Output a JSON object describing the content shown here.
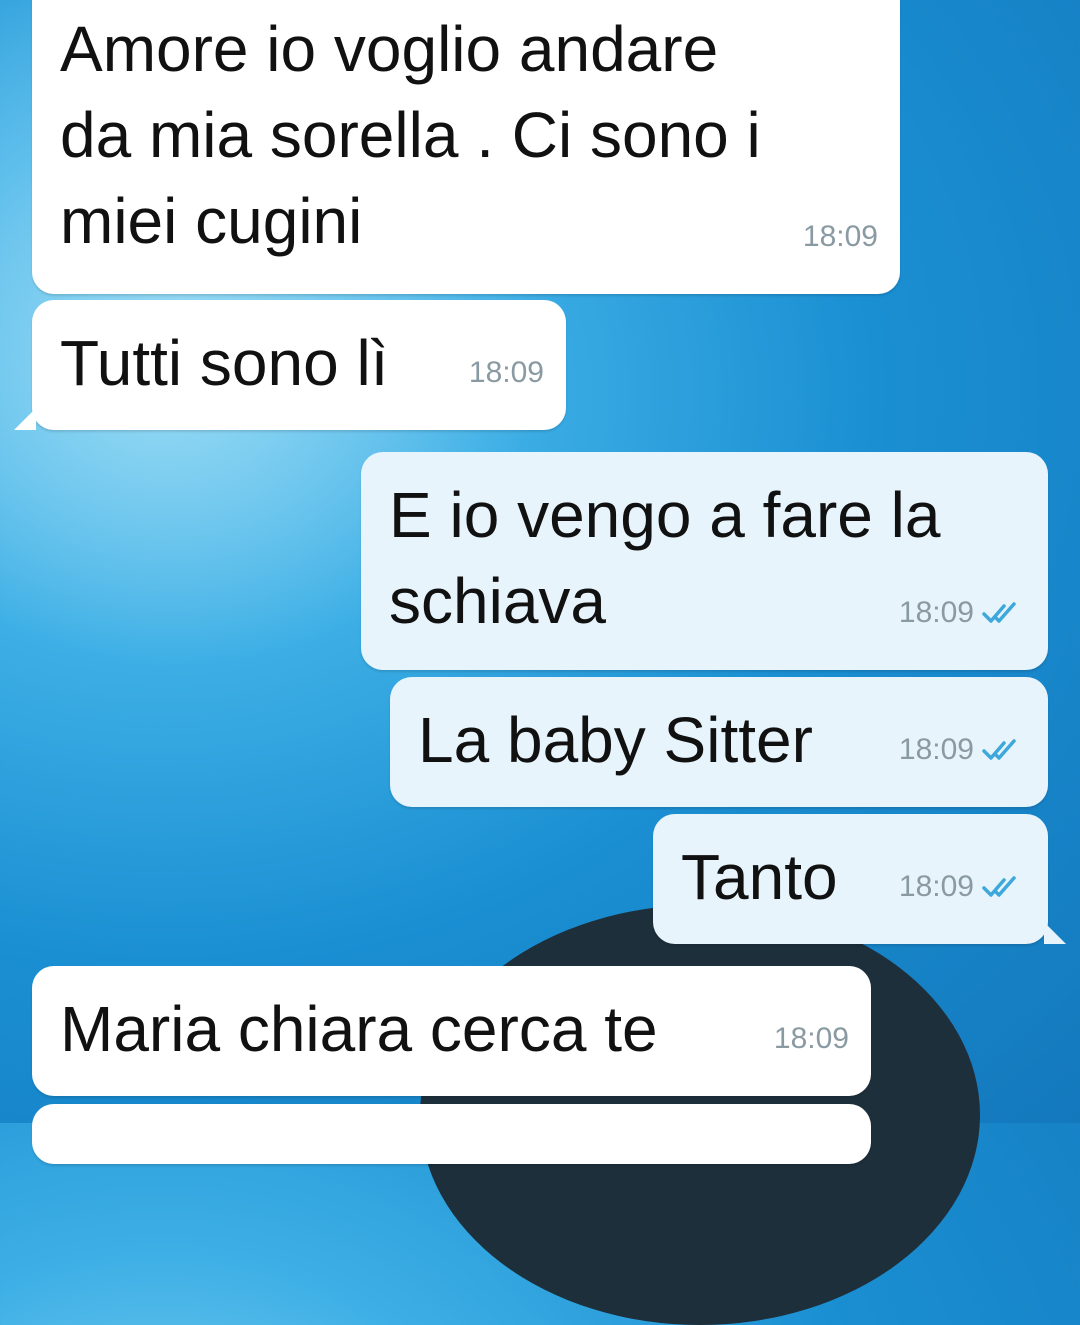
{
  "messages": [
    {
      "direction": "incoming",
      "text": "Amore io voglio andare\nda mia sorella . Ci sono i\nmiei cugini",
      "time": "18:09"
    },
    {
      "direction": "incoming",
      "text": "Tutti sono lì",
      "time": "18:09"
    },
    {
      "direction": "outgoing",
      "text": "E io vengo a fare la\nschiava",
      "time": "18:09",
      "status_icon": "double-check-icon"
    },
    {
      "direction": "outgoing",
      "text": "La baby Sitter",
      "time": "18:09",
      "status_icon": "double-check-icon"
    },
    {
      "direction": "outgoing",
      "text": "Tanto",
      "time": "18:09",
      "status_icon": "double-check-icon"
    },
    {
      "direction": "incoming",
      "text": "Maria chiara cerca te",
      "time": "18:09"
    }
  ],
  "colors": {
    "incoming_bubble": "#ffffff",
    "outgoing_bubble": "#e7f4fc",
    "read_check": "#3ea8dc",
    "timestamp": "#8a9aa3"
  }
}
